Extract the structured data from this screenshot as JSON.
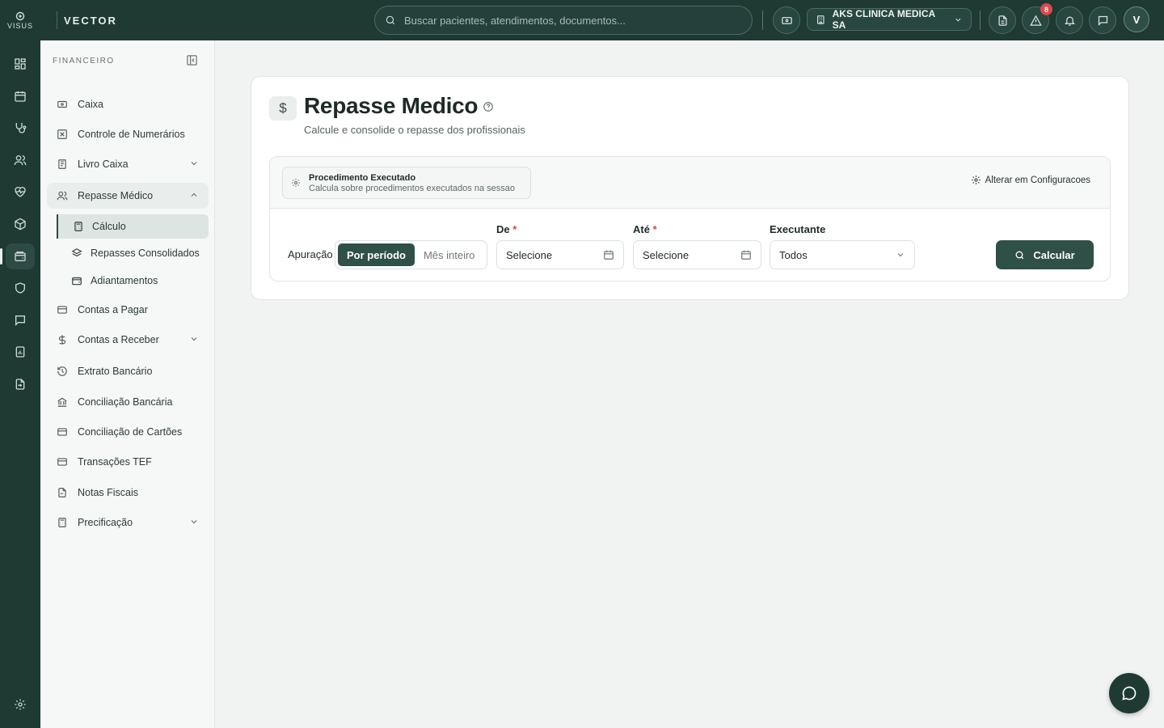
{
  "brand": {
    "logo_text": "VISUS",
    "name": "VECTOR"
  },
  "topbar": {
    "search_placeholder": "Buscar pacientes, atendimentos, documentos...",
    "clinic_name": "AKS CLINICA MEDICA SA",
    "alerts_count": "8",
    "user_initial": "V"
  },
  "sidebar": {
    "section": "FINANCEIRO",
    "items": [
      {
        "label": "Caixa"
      },
      {
        "label": "Controle de Numerários"
      },
      {
        "label": "Livro Caixa"
      },
      {
        "label": "Repasse Médico"
      },
      {
        "label": "Contas a Pagar"
      },
      {
        "label": "Contas a Receber"
      },
      {
        "label": "Extrato Bancário"
      },
      {
        "label": "Conciliação Bancária"
      },
      {
        "label": "Conciliação de Cartões"
      },
      {
        "label": "Transações TEF"
      },
      {
        "label": "Notas Fiscais"
      },
      {
        "label": "Precificação"
      }
    ],
    "subitems": [
      {
        "label": "Cálculo"
      },
      {
        "label": "Repasses Consolidados"
      },
      {
        "label": "Adiantamentos"
      }
    ]
  },
  "page": {
    "icon": "$",
    "title": "Repasse Medico",
    "subtitle": "Calcule e consolide o repasse dos profissionais",
    "procedure_title": "Procedimento Executado",
    "procedure_desc": "Calcula sobre procedimentos executados na sessao",
    "config_link": "Alterar em Configuracoes",
    "apuracao_label": "Apuração",
    "seg_period": "Por período",
    "seg_month": "Mês inteiro",
    "from_label": "De",
    "to_label": "Até",
    "required_mark": "*",
    "executor_label": "Executante",
    "from_value": "Selecione",
    "to_value": "Selecione",
    "executor_value": "Todos",
    "calc_button": "Calcular"
  }
}
